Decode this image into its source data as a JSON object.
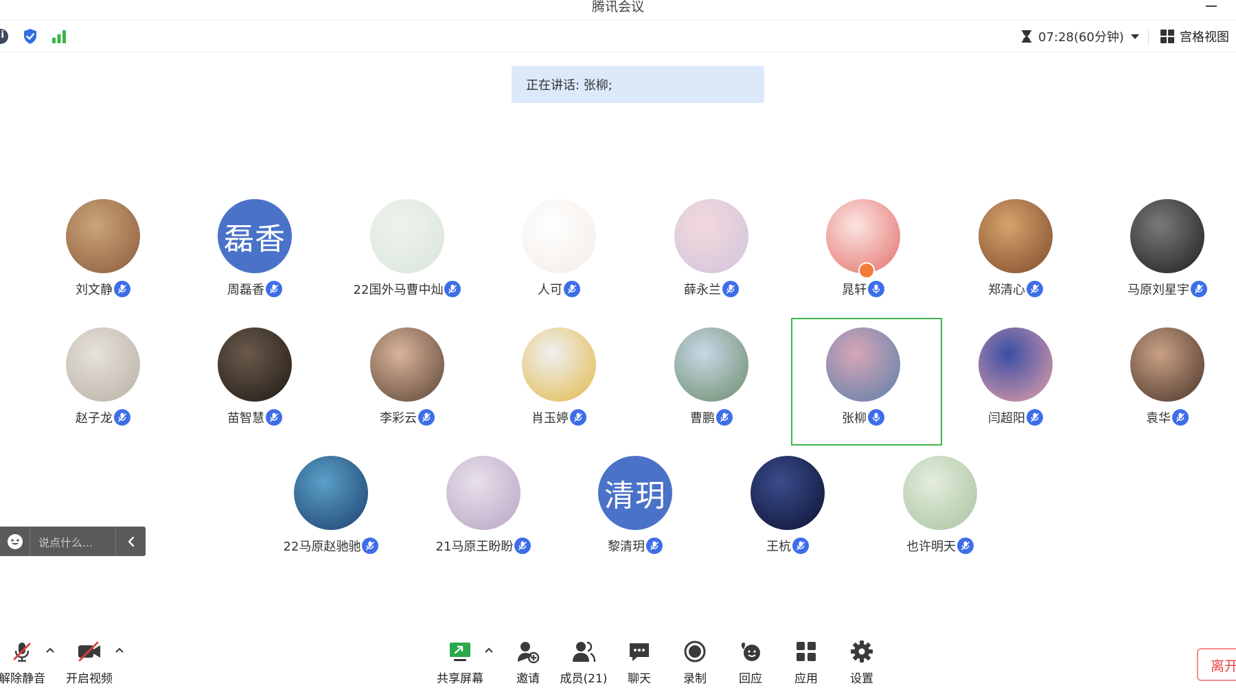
{
  "window": {
    "title": "腾讯会议"
  },
  "status": {
    "timer": "07:28(60分钟)",
    "view_label": "宫格视图"
  },
  "speaking": {
    "text": "正在讲话: 张柳;"
  },
  "participants": [
    {
      "name": "刘文静",
      "avatar_text": "",
      "avatar_colors": [
        "#c9a57a",
        "#8e5a3a"
      ],
      "mic": "muted"
    },
    {
      "name": "周磊香",
      "avatar_text": "磊香",
      "avatar_colors": [
        "#4a72c8",
        "#4a72c8"
      ],
      "mic": "muted"
    },
    {
      "name": "22国外马曹中灿",
      "avatar_text": "",
      "avatar_colors": [
        "#eef4ee",
        "#d9e4d9"
      ],
      "mic": "muted"
    },
    {
      "name": "人可",
      "avatar_text": "",
      "avatar_colors": [
        "#ffffff",
        "#f3ece6"
      ],
      "mic": "muted"
    },
    {
      "name": "薛永兰",
      "avatar_text": "",
      "avatar_colors": [
        "#f4d9dc",
        "#cfc4dc"
      ],
      "mic": "muted"
    },
    {
      "name": "晁轩",
      "avatar_text": "",
      "avatar_colors": [
        "#fbe4e2",
        "#e4706a"
      ],
      "mic": "active"
    },
    {
      "name": "郑清心",
      "avatar_text": "",
      "avatar_colors": [
        "#d7a26c",
        "#7d4b2c"
      ],
      "mic": "muted"
    },
    {
      "name": "马原刘星宇",
      "avatar_text": "",
      "avatar_colors": [
        "#7a7a7a",
        "#1e1e1e"
      ],
      "mic": "muted"
    },
    {
      "name": "赵子龙",
      "avatar_text": "",
      "avatar_colors": [
        "#e6e1da",
        "#b8b0a6"
      ],
      "mic": "muted"
    },
    {
      "name": "苗智慧",
      "avatar_text": "",
      "avatar_colors": [
        "#6b5a4c",
        "#1f1914"
      ],
      "mic": "muted"
    },
    {
      "name": "李彩云",
      "avatar_text": "",
      "avatar_colors": [
        "#d9b49a",
        "#5b4436"
      ],
      "mic": "muted"
    },
    {
      "name": "肖玉婷",
      "avatar_text": "",
      "avatar_colors": [
        "#eef0f2",
        "#e3b94a"
      ],
      "mic": "muted"
    },
    {
      "name": "曹鹏",
      "avatar_text": "",
      "avatar_colors": [
        "#c9d8e6",
        "#6b8c6b"
      ],
      "mic": "muted"
    },
    {
      "name": "张柳",
      "avatar_text": "",
      "avatar_colors": [
        "#d8a6b8",
        "#5a7fa8"
      ],
      "mic": "active"
    },
    {
      "name": "闫超阳",
      "avatar_text": "",
      "avatar_colors": [
        "#3b4fa6",
        "#e6a0a8"
      ],
      "mic": "muted"
    },
    {
      "name": "袁华",
      "avatar_text": "",
      "avatar_colors": [
        "#c9a184",
        "#4a342a"
      ],
      "mic": "muted"
    },
    {
      "name": "22马原赵驰驰",
      "avatar_text": "",
      "avatar_colors": [
        "#5aa0c8",
        "#1c3f6e"
      ],
      "mic": "muted"
    },
    {
      "name": "21马原王盼盼",
      "avatar_text": "",
      "avatar_colors": [
        "#e8e0ea",
        "#b7a4c4"
      ],
      "mic": "muted"
    },
    {
      "name": "黎清玥",
      "avatar_text": "清玥",
      "avatar_colors": [
        "#4a72c8",
        "#4a72c8"
      ],
      "mic": "muted"
    },
    {
      "name": "王杭",
      "avatar_text": "",
      "avatar_colors": [
        "#3a4c8c",
        "#0c1230"
      ],
      "mic": "muted"
    },
    {
      "name": "也许明天",
      "avatar_text": "",
      "avatar_colors": [
        "#e4ecdc",
        "#a7c4a0"
      ],
      "mic": "muted"
    }
  ],
  "chat": {
    "placeholder": "说点什么..."
  },
  "toolbar": {
    "unmute": "解除静音",
    "video": "开启视频",
    "share": "共享屏幕",
    "invite": "邀请",
    "members": "成员(21)",
    "chat": "聊天",
    "record": "录制",
    "react": "回应",
    "apps": "应用",
    "settings": "设置",
    "leave": "离开"
  },
  "colors": {
    "accent": "#3d6ee8",
    "speaking_bg": "#dce9fb",
    "active_frame": "#3bb54a",
    "leave": "#e94545"
  }
}
